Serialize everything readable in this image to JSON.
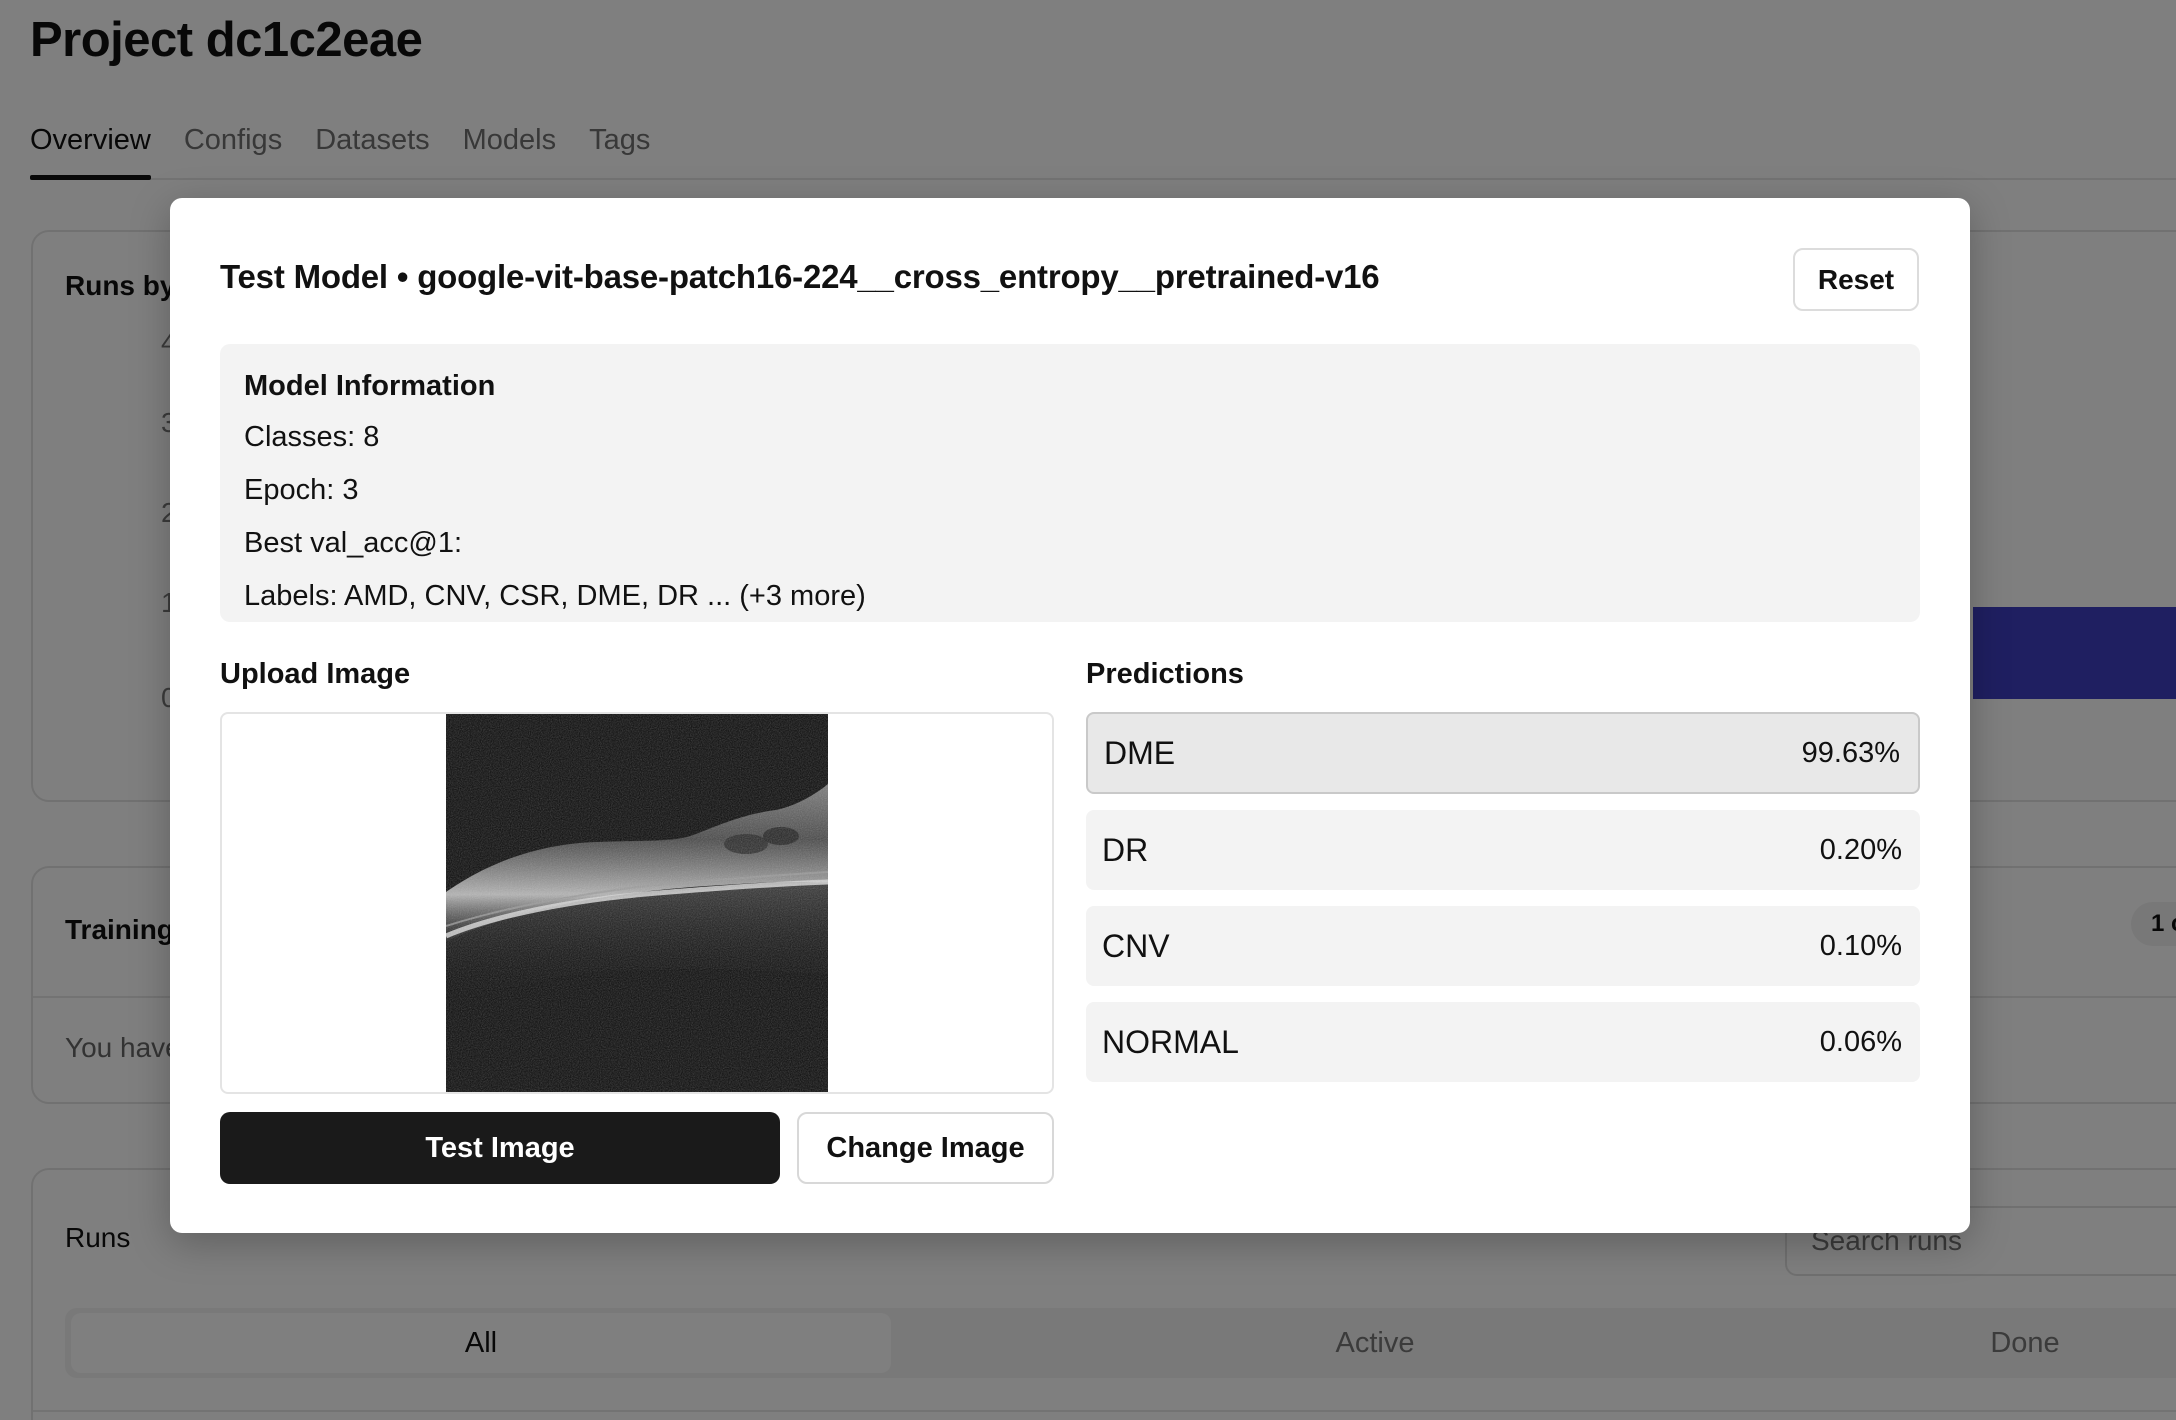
{
  "page": {
    "title": "Project dc1c2eae",
    "tabs": [
      {
        "label": "Overview",
        "active": true
      },
      {
        "label": "Configs"
      },
      {
        "label": "Datasets"
      },
      {
        "label": "Models"
      },
      {
        "label": "Tags"
      }
    ],
    "runs_by_card": {
      "title": "Runs by",
      "y_ticks": [
        "4",
        "3",
        "2",
        "1",
        "0"
      ],
      "bar_color": "#3f3fc2"
    },
    "training_card": {
      "title": "Training",
      "empty_text": "You have",
      "badge": "1 c"
    },
    "runs_card": {
      "title": "Runs",
      "search_placeholder": "Search runs",
      "filters": [
        "All",
        "Active",
        "Done"
      ]
    }
  },
  "modal": {
    "title": "Test Model • google-vit-base-patch16-224__cross_entropy__pretrained-v16",
    "reset_label": "Reset",
    "model_info": {
      "heading": "Model Information",
      "classes": "Classes: 8",
      "epoch": "Epoch: 3",
      "best_val": "Best val_acc@1:",
      "labels": "Labels: AMD, CNV, CSR, DME, DR ... (+3 more)"
    },
    "upload_label": "Upload Image",
    "predictions_label": "Predictions",
    "predictions": [
      {
        "label": "DME",
        "value": "99.63%"
      },
      {
        "label": "DR",
        "value": "0.20%"
      },
      {
        "label": "CNV",
        "value": "0.10%"
      },
      {
        "label": "NORMAL",
        "value": "0.06%"
      }
    ],
    "test_button": "Test Image",
    "change_button": "Change Image",
    "image_icon": "oct-scan-image"
  }
}
